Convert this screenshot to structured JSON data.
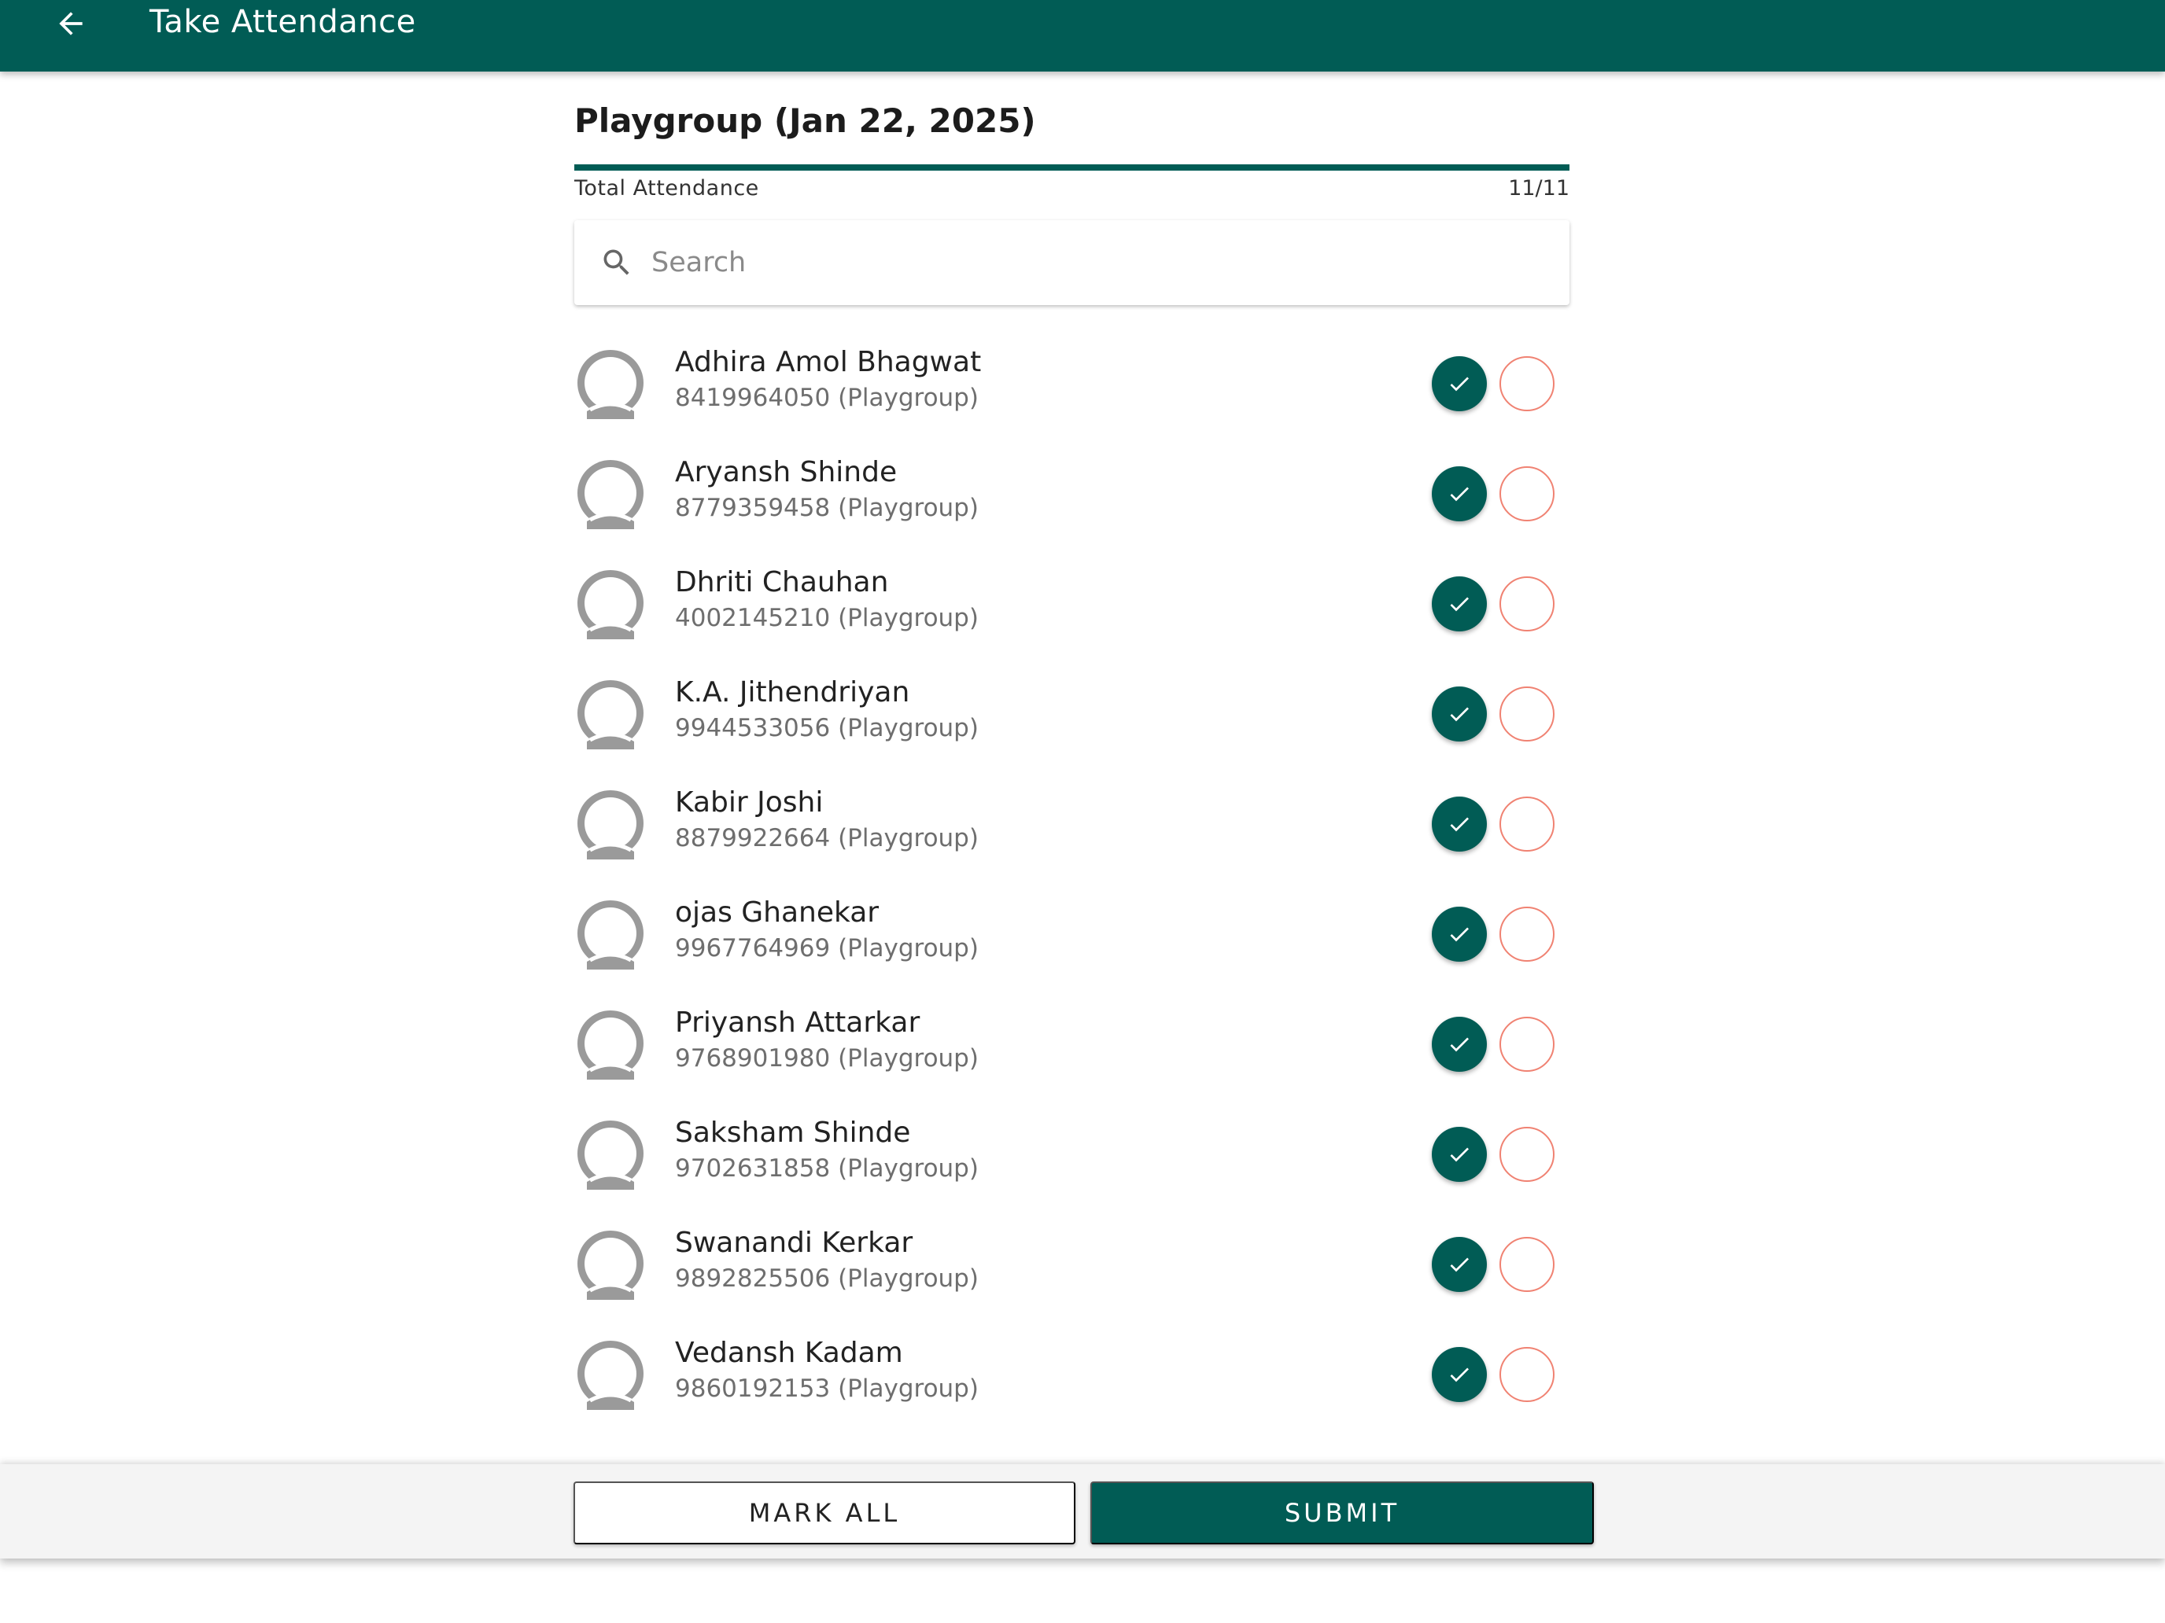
{
  "appbar": {
    "title": "Take Attendance"
  },
  "header": {
    "class_title": "Playgroup (Jan 22, 2025)",
    "total_label": "Total Attendance",
    "total_count": "11/11",
    "progress_fraction": 1.0
  },
  "search": {
    "placeholder": "Search",
    "value": ""
  },
  "students": [
    {
      "name": "Adhira Amol Bhagwat",
      "sub": "8419964050 (Playgroup)",
      "status": "present"
    },
    {
      "name": "Aryansh Shinde",
      "sub": "8779359458 (Playgroup)",
      "status": "present"
    },
    {
      "name": "Dhriti Chauhan",
      "sub": "4002145210 (Playgroup)",
      "status": "present"
    },
    {
      "name": "K.A. Jithendriyan",
      "sub": "9944533056 (Playgroup)",
      "status": "present"
    },
    {
      "name": "Kabir Joshi",
      "sub": "8879922664 (Playgroup)",
      "status": "present"
    },
    {
      "name": "ojas Ghanekar",
      "sub": "9967764969 (Playgroup)",
      "status": "present"
    },
    {
      "name": "Priyansh Attarkar",
      "sub": "9768901980 (Playgroup)",
      "status": "present"
    },
    {
      "name": "Saksham Shinde",
      "sub": "9702631858 (Playgroup)",
      "status": "present"
    },
    {
      "name": "Swanandi Kerkar",
      "sub": "9892825506 (Playgroup)",
      "status": "present"
    },
    {
      "name": "Vedansh Kadam",
      "sub": "9860192153 (Playgroup)",
      "status": "present"
    }
  ],
  "footer": {
    "mark_all_label": "MARK ALL",
    "submit_label": "SUBMIT"
  },
  "colors": {
    "primary": "#015c55",
    "absent_outline": "#f08272",
    "avatar": "#9a9a9a"
  },
  "icons": {
    "back": "arrow-left-icon",
    "search": "search-icon",
    "avatar": "person-icon",
    "present": "check-icon"
  }
}
